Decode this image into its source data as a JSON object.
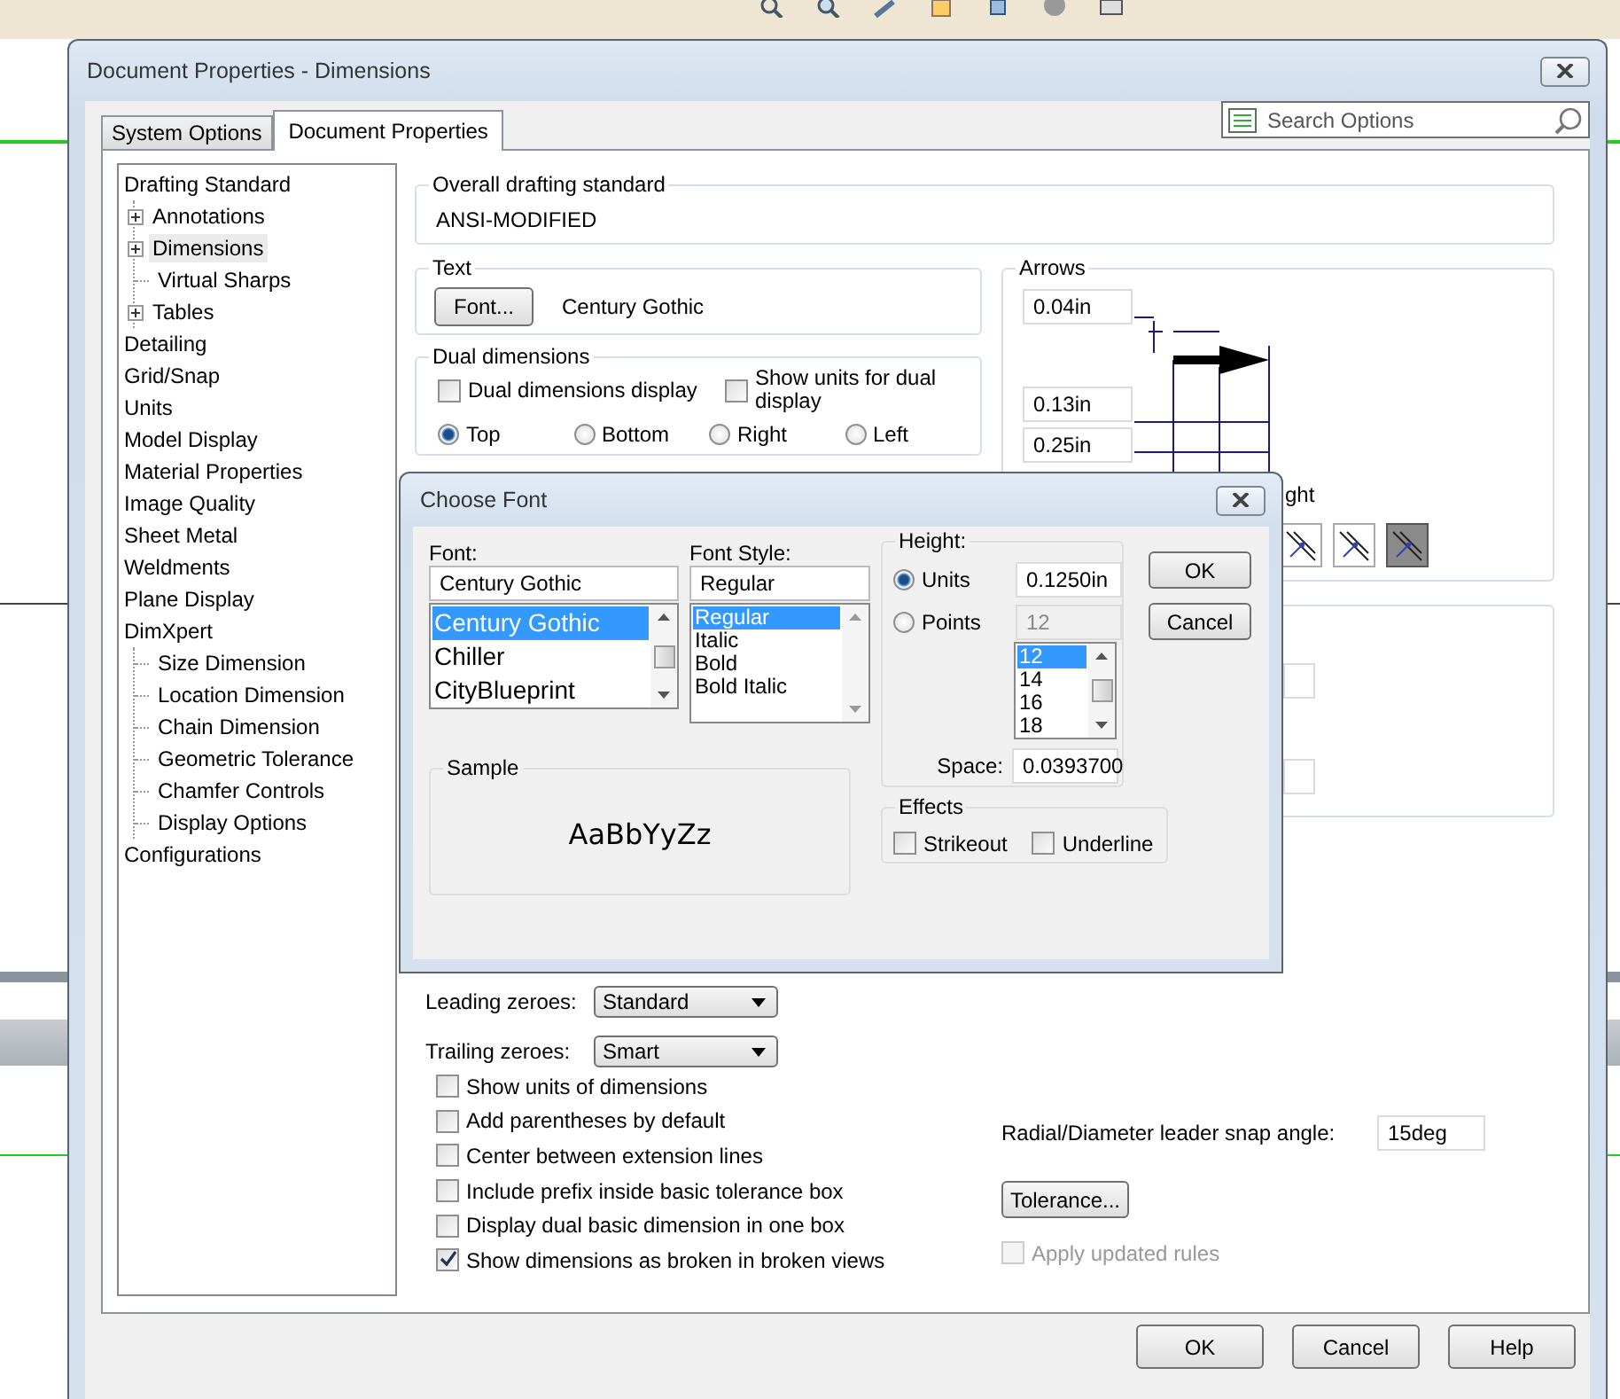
{
  "window": {
    "title": "Document Properties - Dimensions"
  },
  "tabs": [
    {
      "label": "System Options",
      "selected": false
    },
    {
      "label": "Document Properties",
      "selected": true
    }
  ],
  "search": {
    "placeholder": "Search Options"
  },
  "tree": [
    {
      "label": "Drafting Standard",
      "selected": false,
      "children": [
        {
          "label": "Annotations",
          "kind": "expandable",
          "expanded": false,
          "selected": false
        },
        {
          "label": "Dimensions",
          "kind": "expandable",
          "expanded": false,
          "selected": true
        },
        {
          "label": "Virtual Sharps",
          "kind": "leaf",
          "selected": false
        },
        {
          "label": "Tables",
          "kind": "expandable",
          "expanded": false,
          "selected": false
        }
      ]
    },
    {
      "label": "Detailing",
      "selected": false
    },
    {
      "label": "Grid/Snap",
      "selected": false
    },
    {
      "label": "Units",
      "selected": false
    },
    {
      "label": "Model Display",
      "selected": false
    },
    {
      "label": "Material Properties",
      "selected": false
    },
    {
      "label": "Image Quality",
      "selected": false
    },
    {
      "label": "Sheet Metal",
      "selected": false
    },
    {
      "label": "Weldments",
      "selected": false
    },
    {
      "label": "Plane Display",
      "selected": false
    },
    {
      "label": "DimXpert",
      "selected": false,
      "children": [
        {
          "label": "Size Dimension",
          "kind": "leaf",
          "selected": false
        },
        {
          "label": "Location Dimension",
          "kind": "leaf",
          "selected": false
        },
        {
          "label": "Chain Dimension",
          "kind": "leaf",
          "selected": false
        },
        {
          "label": "Geometric Tolerance",
          "kind": "leaf",
          "selected": false
        },
        {
          "label": "Chamfer Controls",
          "kind": "leaf",
          "selected": false
        },
        {
          "label": "Display Options",
          "kind": "leaf",
          "selected": false
        }
      ]
    },
    {
      "label": "Configurations",
      "selected": false
    }
  ],
  "overall_standard": {
    "label": "Overall drafting standard",
    "value": "ANSI-MODIFIED"
  },
  "text_group": {
    "label": "Text",
    "button": "Font...",
    "font_name": "Century Gothic"
  },
  "dual_dimensions": {
    "label": "Dual dimensions",
    "checkboxes": [
      {
        "label": "Dual dimensions display",
        "checked": false
      },
      {
        "label": "Show units for dual display",
        "checked": false
      }
    ],
    "positions": [
      {
        "label": "Top",
        "selected": true
      },
      {
        "label": "Bottom",
        "selected": false
      },
      {
        "label": "Right",
        "selected": false
      },
      {
        "label": "Left",
        "selected": false
      }
    ]
  },
  "arrows": {
    "label": "Arrows",
    "fields": [
      "0.04in",
      "0.13in",
      "0.25in"
    ],
    "partial_label": "ght",
    "styles": [
      {
        "selected": false
      },
      {
        "selected": false
      },
      {
        "selected": true
      }
    ]
  },
  "zeroes": [
    {
      "label": "Leading zeroes:",
      "value": "Standard"
    },
    {
      "label": "Trailing zeroes:",
      "value": "Smart"
    }
  ],
  "options": [
    {
      "label": "Show units of dimensions",
      "checked": false
    },
    {
      "label": "Add parentheses by default",
      "checked": false
    },
    {
      "label": "Center between extension lines",
      "checked": false
    },
    {
      "label": "Include prefix inside basic tolerance box",
      "checked": false
    },
    {
      "label": "Display dual basic dimension in one box",
      "checked": false
    },
    {
      "label": "Show dimensions as broken in broken views",
      "checked": true
    }
  ],
  "snap_angle": {
    "label": "Radial/Diameter leader snap angle:",
    "value": "15deg"
  },
  "tolerance_button": "Tolerance...",
  "apply_rules": {
    "label": "Apply updated rules",
    "checked": false,
    "disabled": true
  },
  "footer_buttons": [
    "OK",
    "Cancel",
    "Help"
  ],
  "font_dialog": {
    "title": "Choose Font",
    "font": {
      "label": "Font:",
      "value": "Century Gothic",
      "options": [
        {
          "text": "Century Gothic",
          "selected": true
        },
        {
          "text": "Chiller",
          "selected": false
        },
        {
          "text": "CityBlueprint",
          "selected": false
        }
      ]
    },
    "style": {
      "label": "Font Style:",
      "value": "Regular",
      "options": [
        {
          "text": "Regular",
          "selected": true
        },
        {
          "text": "Italic",
          "selected": false
        },
        {
          "text": "Bold",
          "selected": false
        },
        {
          "text": "Bold Italic",
          "selected": false
        }
      ]
    },
    "height": {
      "label": "Height:",
      "modes": [
        {
          "label": "Units",
          "selected": true,
          "value": "0.1250in",
          "disabled": false
        },
        {
          "label": "Points",
          "selected": false,
          "value": "12",
          "disabled": true
        }
      ],
      "sizes": [
        {
          "text": "12",
          "selected": true
        },
        {
          "text": "14",
          "selected": false
        },
        {
          "text": "16",
          "selected": false
        },
        {
          "text": "18",
          "selected": false
        }
      ],
      "space_label": "Space:",
      "space_value": "0.0393700"
    },
    "sample": {
      "label": "Sample",
      "text": "AaBbYyZz"
    },
    "effects": {
      "label": "Effects",
      "options": [
        {
          "label": "Strikeout",
          "checked": false
        },
        {
          "label": "Underline",
          "checked": false
        }
      ]
    },
    "buttons": [
      "OK",
      "Cancel"
    ]
  }
}
